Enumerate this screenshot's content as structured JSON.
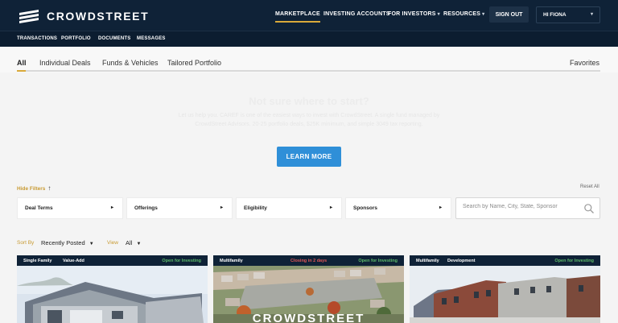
{
  "brand": {
    "name": "CROWDSTREET"
  },
  "topnav": {
    "items": [
      {
        "label": "MARKETPLACE",
        "active": true
      },
      {
        "label": "INVESTING ACCOUNTS"
      },
      {
        "label": "FOR INVESTORS",
        "dropdown": true
      },
      {
        "label": "RESOURCES",
        "dropdown": true
      }
    ],
    "sign_out": "SIGN OUT",
    "account": "HI FIONA"
  },
  "subnav": {
    "items": [
      "TRANSACTIONS",
      "PORTFOLIO",
      "DOCUMENTS",
      "MESSAGES"
    ]
  },
  "tabs": {
    "items": [
      "All",
      "Individual Deals",
      "Funds & Vehicles",
      "Tailored Portfolio"
    ],
    "active_index": 0,
    "favorites": "Favorites"
  },
  "hero": {
    "title": "Not sure where to start?",
    "subtitle": "Let us help you. CAREF is one of the easiest ways to invest with CrowdStreet. A single fund managed by CrowdStreet Advisors. 20-25 portfolio deals, $25K minimum, and simple 3049 tax reporting.",
    "button": "LEARN MORE"
  },
  "filters": {
    "hide_label": "Hide Filters",
    "reset_label": "Reset All",
    "items": [
      "Deal Terms",
      "Offerings",
      "Eligibility",
      "Sponsors"
    ],
    "search_placeholder": "Search by Name, City, State, Sponsor"
  },
  "sort": {
    "label": "Sort By",
    "value": "Recently Posted"
  },
  "view": {
    "label": "View",
    "value": "All"
  },
  "cards": [
    {
      "tag_a": "Single Family",
      "tag_b": "Value-Add",
      "status": "Open for Investing",
      "closing": ""
    },
    {
      "tag_a": "Multifamily",
      "tag_b": "",
      "status": "Open for Investing",
      "closing": "Closing in 2 days"
    },
    {
      "tag_a": "Multifamily",
      "tag_b": "Development",
      "status": "Open for Investing",
      "closing": ""
    }
  ],
  "watermark": "CROWDSTREET",
  "colors": {
    "navy": "#0f2237",
    "gold": "#d9a93a",
    "blue_button": "#2f8fd8",
    "open_green": "#5dbb6a",
    "closing_red": "#e05656"
  }
}
